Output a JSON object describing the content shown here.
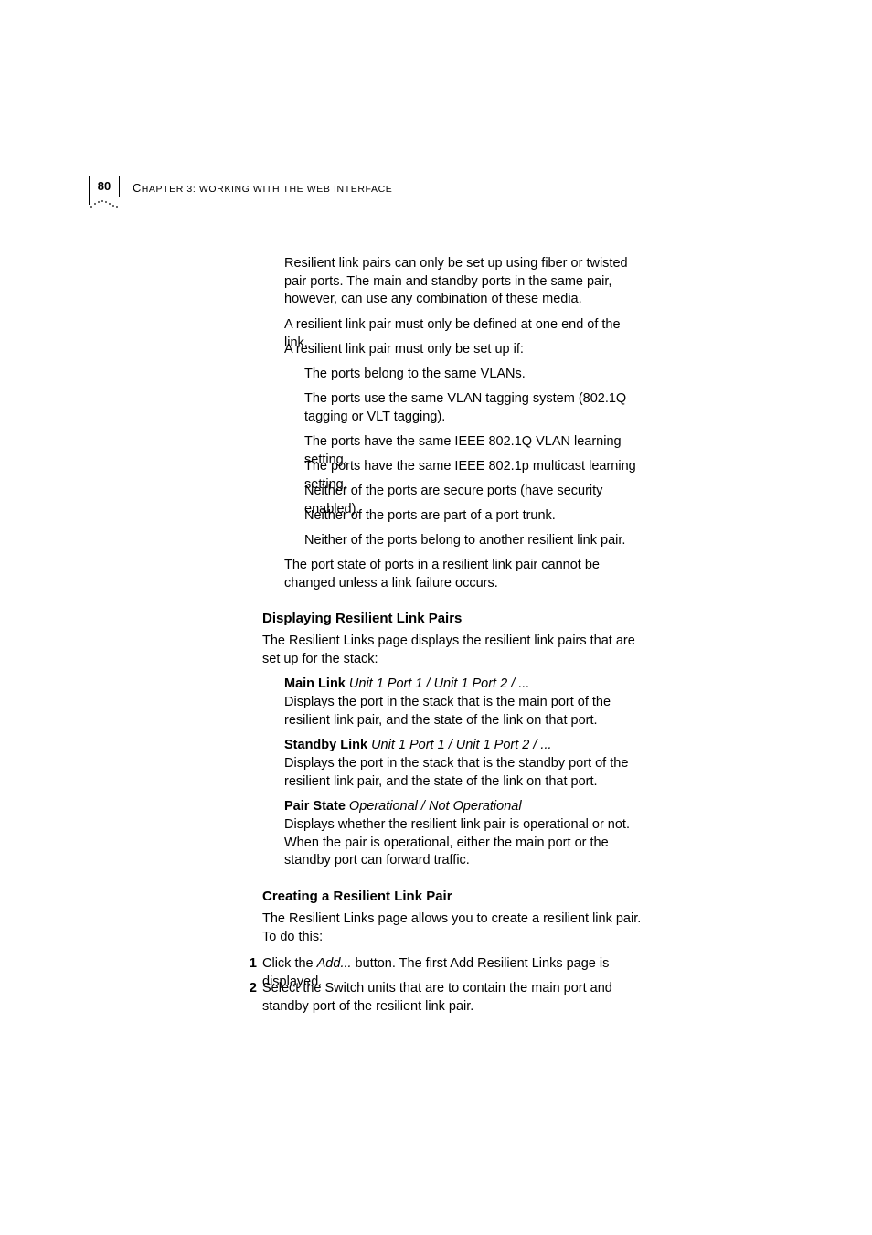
{
  "header": {
    "page_number": "80",
    "chapter_label": "C",
    "chapter_rest": "HAPTER 3: WORKING WITH THE WEB INTERFACE"
  },
  "body": {
    "p1": "Resilient link pairs can only be set up using fiber or twisted pair ports. The main and standby ports in the same pair, however, can use any combination of these media.",
    "p2": "A resilient link pair must only be defined at one end of the link.",
    "p3": "A resilient link pair must only be set up if:",
    "b1": "The ports belong to the same VLANs.",
    "b2": "The ports use the same VLAN tagging system (802.1Q tagging or VLT tagging).",
    "b3": "The ports have the same IEEE 802.1Q VLAN learning setting.",
    "b4": "The ports have the same IEEE 802.1p multicast learning setting.",
    "b5": "Neither of the ports are secure ports (have security enabled).",
    "b6": "Neither of the ports are part of a port trunk.",
    "b7": "Neither of the ports belong to another resilient link pair.",
    "p4": "The port state of ports in a resilient link pair cannot be changed unless a link failure occurs."
  },
  "section_display": {
    "title": "Displaying Resilient Link Pairs",
    "intro": "The Resilient Links page displays the resilient link pairs that are set up for the stack:",
    "main_link_label": "Main Link",
    "main_link_opts": " Unit 1 Port 1 / Unit 1 Port 2 / ...",
    "main_link_desc": "Displays the port in the stack that is the main port of the resilient link pair, and the state of the link on that port.",
    "standby_link_label": "Standby Link",
    "standby_link_opts": " Unit 1 Port 1 / Unit 1 Port 2 / ...",
    "standby_link_desc": "Displays the port in the stack that is the standby port of the resilient link pair, and the state of the link on that port.",
    "pair_state_label": "Pair State",
    "pair_state_opts": " Operational / Not Operational",
    "pair_state_desc": "Displays whether the resilient link pair is operational or not. When the pair is operational, either the main port or the standby port can forward traffic."
  },
  "section_create": {
    "title": "Creating a Resilient Link Pair",
    "intro": "The Resilient Links page allows you to create a resilient link pair. To do this:",
    "step1_num": "1",
    "step1_a": "Click the ",
    "step1_add": "Add...",
    "step1_b": " button. The first Add Resilient Links page is displayed.",
    "step2_num": "2",
    "step2": "Select the Switch units that are to contain the main port and standby port of the resilient link pair."
  }
}
